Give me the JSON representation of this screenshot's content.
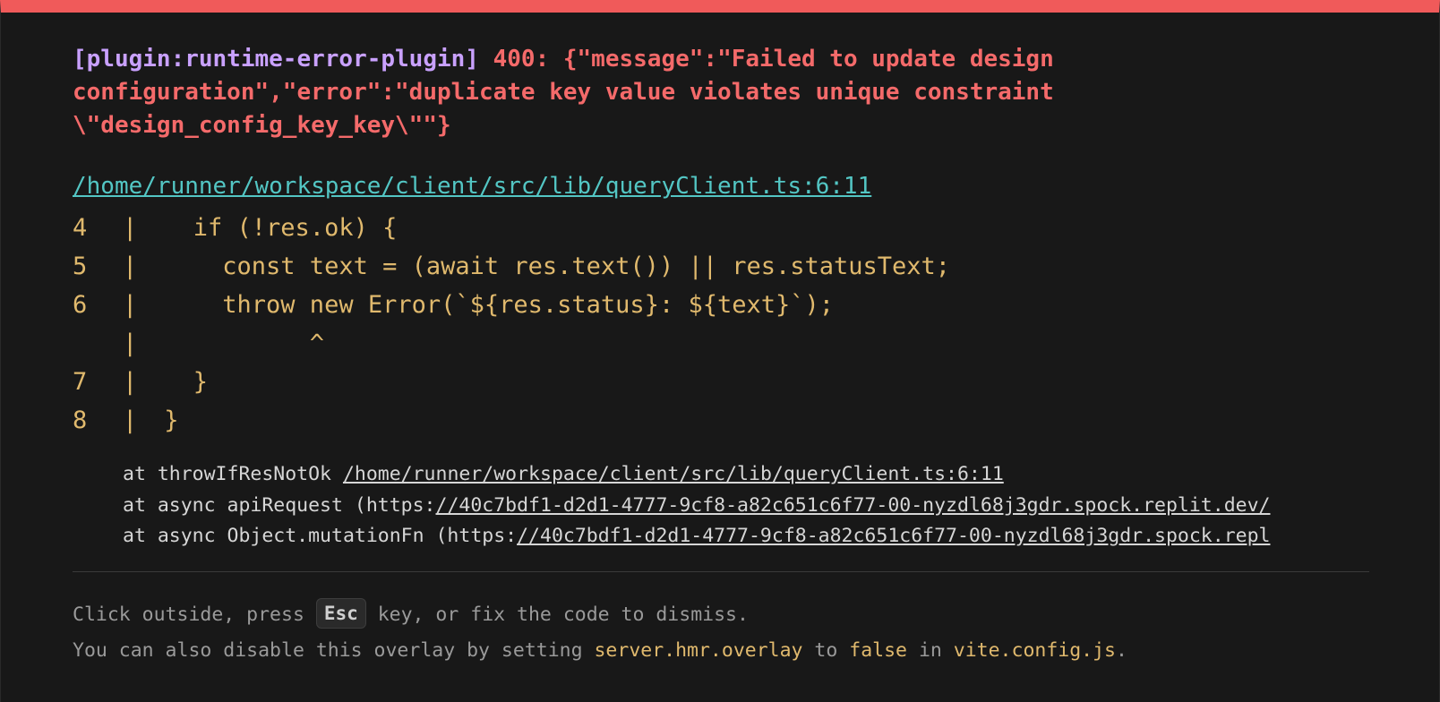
{
  "overlay": {
    "plugin": "[plugin:runtime-error-plugin]",
    "message": "400: {\"message\":\"Failed to update design configuration\",\"error\":\"duplicate key value violates unique constraint \\\"design_config_key_key\\\"\"}",
    "file": "/home/runner/workspace/client/src/lib/queryClient.ts:6:11",
    "frame": [
      {
        "line": "4",
        "bar": "|",
        "code": "   if (!res.ok) {"
      },
      {
        "line": "5",
        "bar": "|",
        "code": "     const text = (await res.text()) || res.statusText;"
      },
      {
        "line": "6",
        "bar": "|",
        "code": "     throw new Error(`${res.status}: ${text}`);"
      },
      {
        "line": "",
        "bar": "|",
        "code": "           ^"
      },
      {
        "line": "7",
        "bar": "|",
        "code": "   }"
      },
      {
        "line": "8",
        "bar": "|",
        "code": " }"
      }
    ],
    "stack": [
      {
        "prefix": "at throwIfResNotOk ",
        "link": "/home/runner/workspace/client/src/lib/queryClient.ts:6:11"
      },
      {
        "prefix": "at async apiRequest (https:",
        "link": "//40c7bdf1-d2d1-4777-9cf8-a82c651c6f77-00-nyzdl68j3gdr.spock.replit.dev/"
      },
      {
        "prefix": "at async Object.mutationFn (https:",
        "link": "//40c7bdf1-d2d1-4777-9cf8-a82c651c6f77-00-nyzdl68j3gdr.spock.repl"
      }
    ],
    "tip1": {
      "before": "Click outside, press ",
      "key": "Esc",
      "after": " key, or fix the code to dismiss."
    },
    "tip2": {
      "t1": "You can also disable this overlay by setting ",
      "c1": "server.hmr.overlay",
      "t2": " to ",
      "c2": "false",
      "t3": " in ",
      "c3": "vite.config.js",
      "t4": "."
    }
  }
}
